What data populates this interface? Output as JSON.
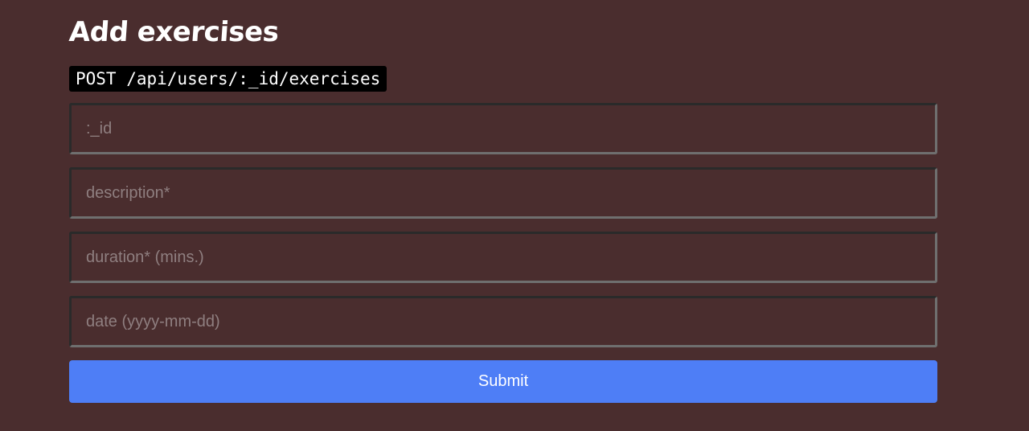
{
  "form": {
    "title": "Add exercises",
    "endpoint": "POST /api/users/:_id/exercises",
    "fields": [
      {
        "name": "id",
        "placeholder": ":_id",
        "value": ""
      },
      {
        "name": "description",
        "placeholder": "description*",
        "value": ""
      },
      {
        "name": "duration",
        "placeholder": "duration* (mins.)",
        "value": ""
      },
      {
        "name": "date",
        "placeholder": "date (yyyy-mm-dd)",
        "value": ""
      }
    ],
    "submit_label": "Submit"
  },
  "colors": {
    "background": "#4a2d2e",
    "button": "#4e7ef6",
    "code_background": "#000000",
    "placeholder": "#8f7f80"
  }
}
